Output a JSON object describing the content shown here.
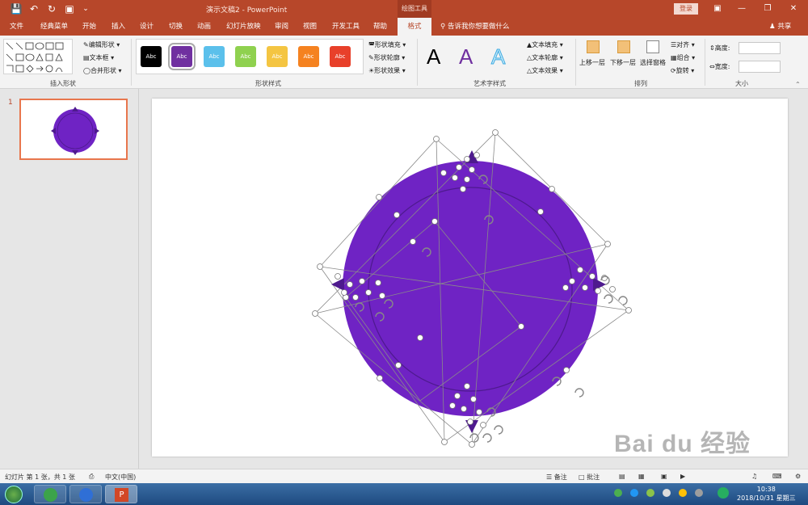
{
  "titlebar": {
    "doc_title": "演示文稿2  -  PowerPoint",
    "context_tool": "绘图工具",
    "login": "登录",
    "qa_icons": [
      "save-icon",
      "undo-icon",
      "redo-icon",
      "presenter-icon",
      "customize-icon"
    ]
  },
  "tabs": [
    "文件",
    "经典菜单",
    "开始",
    "插入",
    "设计",
    "切换",
    "动画",
    "幻灯片放映",
    "审阅",
    "视图",
    "开发工具",
    "帮助"
  ],
  "active_tab": "格式",
  "tell_me": "告诉我你想要做什么",
  "share": "共享",
  "ribbon": {
    "insert_shapes": {
      "label": "插入形状",
      "edit_shape": "编辑形状",
      "text_box": "文本框",
      "merge_shapes": "合并形状"
    },
    "shape_styles": {
      "label": "形状样式",
      "swatches": [
        {
          "text": "Abc",
          "color": "#000000"
        },
        {
          "text": "Abc",
          "color": "#7030a0"
        },
        {
          "text": "Abc",
          "color": "#5bc0eb"
        },
        {
          "text": "Abc",
          "color": "#8fd14f"
        },
        {
          "text": "Abc",
          "color": "#f4c542"
        },
        {
          "text": "Abc",
          "color": "#f58220"
        },
        {
          "text": "Abc",
          "color": "#e8402a"
        }
      ],
      "fill": "形状填充",
      "outline": "形状轮廓",
      "effects": "形状效果"
    },
    "wordart": {
      "label": "艺术字样式",
      "letters": [
        "A",
        "A",
        "A"
      ],
      "text_fill": "文本填充",
      "text_outline": "文本轮廓",
      "text_effects": "文本效果"
    },
    "arrange": {
      "label": "排列",
      "bring_forward": "上移一层",
      "send_backward": "下移一层",
      "selection_pane": "选择窗格",
      "align": "对齐",
      "group": "组合",
      "rotate": "旋转"
    },
    "size": {
      "label": "大小",
      "height": "高度:",
      "width": "宽度:",
      "height_value": "",
      "width_value": ""
    }
  },
  "slides": {
    "number": "1"
  },
  "shape_color": "#6f23c4",
  "accent": "#b7472a",
  "status": {
    "slide_info": "幻灯片 第 1 张，共 1 张",
    "language": "中文(中国)",
    "notes": "备注",
    "comments": "批注"
  },
  "taskbar": {
    "time": "10:38",
    "date": "2018/10/31 星期三"
  },
  "watermark": "Bai du 经验"
}
